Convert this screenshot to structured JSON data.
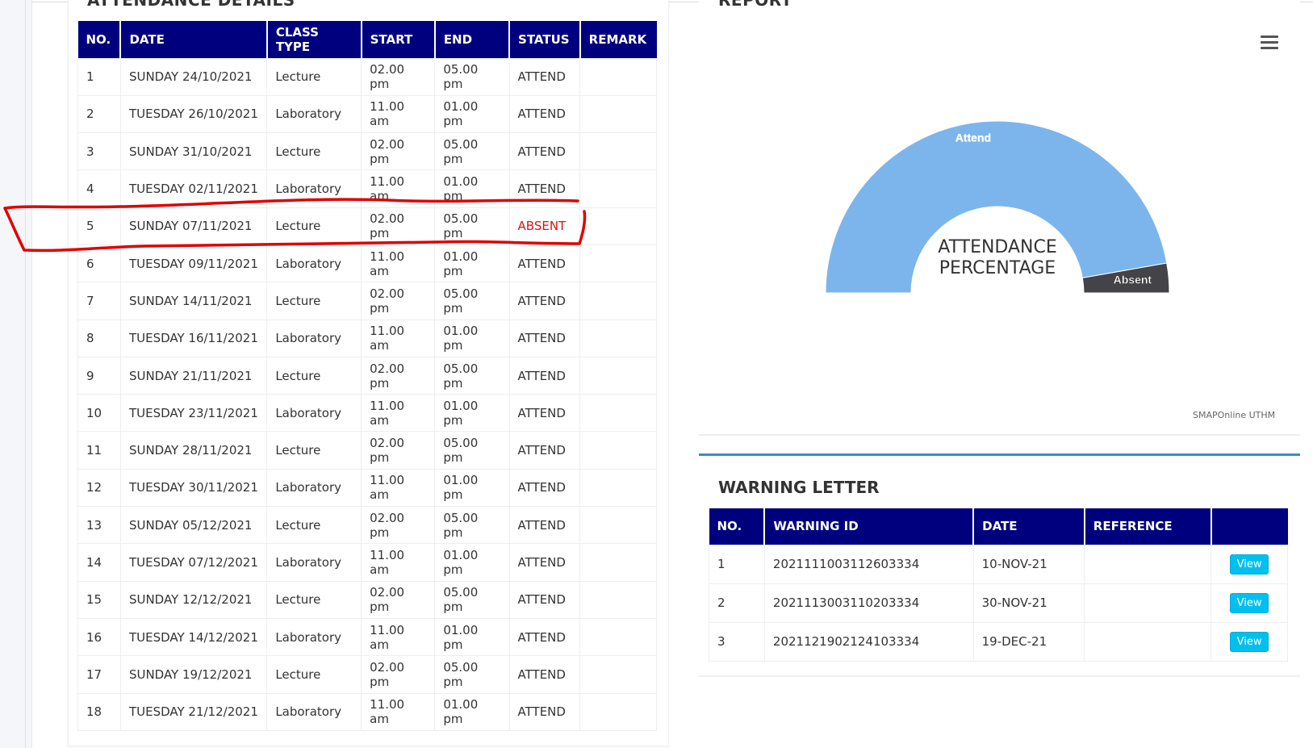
{
  "attendance": {
    "title": "ATTENDANCE DETAILS",
    "headers": [
      "NO.",
      "DATE",
      "CLASS TYPE",
      "START",
      "END",
      "STATUS",
      "REMARK"
    ],
    "rows": [
      {
        "no": "1",
        "date": "SUNDAY 24/10/2021",
        "type": "Lecture",
        "start": "02.00 pm",
        "end": "05.00 pm",
        "status": "ATTEND",
        "remark": ""
      },
      {
        "no": "2",
        "date": "TUESDAY 26/10/2021",
        "type": "Laboratory",
        "start": "11.00 am",
        "end": "01.00 pm",
        "status": "ATTEND",
        "remark": ""
      },
      {
        "no": "3",
        "date": "SUNDAY 31/10/2021",
        "type": "Lecture",
        "start": "02.00 pm",
        "end": "05.00 pm",
        "status": "ATTEND",
        "remark": ""
      },
      {
        "no": "4",
        "date": "TUESDAY 02/11/2021",
        "type": "Laboratory",
        "start": "11.00 am",
        "end": "01.00 pm",
        "status": "ATTEND",
        "remark": ""
      },
      {
        "no": "5",
        "date": "SUNDAY 07/11/2021",
        "type": "Lecture",
        "start": "02.00 pm",
        "end": "05.00 pm",
        "status": "ABSENT",
        "remark": ""
      },
      {
        "no": "6",
        "date": "TUESDAY 09/11/2021",
        "type": "Laboratory",
        "start": "11.00 am",
        "end": "01.00 pm",
        "status": "ATTEND",
        "remark": ""
      },
      {
        "no": "7",
        "date": "SUNDAY 14/11/2021",
        "type": "Lecture",
        "start": "02.00 pm",
        "end": "05.00 pm",
        "status": "ATTEND",
        "remark": ""
      },
      {
        "no": "8",
        "date": "TUESDAY 16/11/2021",
        "type": "Laboratory",
        "start": "11.00 am",
        "end": "01.00 pm",
        "status": "ATTEND",
        "remark": ""
      },
      {
        "no": "9",
        "date": "SUNDAY 21/11/2021",
        "type": "Lecture",
        "start": "02.00 pm",
        "end": "05.00 pm",
        "status": "ATTEND",
        "remark": ""
      },
      {
        "no": "10",
        "date": "TUESDAY 23/11/2021",
        "type": "Laboratory",
        "start": "11.00 am",
        "end": "01.00 pm",
        "status": "ATTEND",
        "remark": ""
      },
      {
        "no": "11",
        "date": "SUNDAY 28/11/2021",
        "type": "Lecture",
        "start": "02.00 pm",
        "end": "05.00 pm",
        "status": "ATTEND",
        "remark": ""
      },
      {
        "no": "12",
        "date": "TUESDAY 30/11/2021",
        "type": "Laboratory",
        "start": "11.00 am",
        "end": "01.00 pm",
        "status": "ATTEND",
        "remark": ""
      },
      {
        "no": "13",
        "date": "SUNDAY 05/12/2021",
        "type": "Lecture",
        "start": "02.00 pm",
        "end": "05.00 pm",
        "status": "ATTEND",
        "remark": ""
      },
      {
        "no": "14",
        "date": "TUESDAY 07/12/2021",
        "type": "Laboratory",
        "start": "11.00 am",
        "end": "01.00 pm",
        "status": "ATTEND",
        "remark": ""
      },
      {
        "no": "15",
        "date": "SUNDAY 12/12/2021",
        "type": "Lecture",
        "start": "02.00 pm",
        "end": "05.00 pm",
        "status": "ATTEND",
        "remark": ""
      },
      {
        "no": "16",
        "date": "TUESDAY 14/12/2021",
        "type": "Laboratory",
        "start": "11.00 am",
        "end": "01.00 pm",
        "status": "ATTEND",
        "remark": ""
      },
      {
        "no": "17",
        "date": "SUNDAY 19/12/2021",
        "type": "Lecture",
        "start": "02.00 pm",
        "end": "05.00 pm",
        "status": "ATTEND",
        "remark": ""
      },
      {
        "no": "18",
        "date": "TUESDAY 21/12/2021",
        "type": "Laboratory",
        "start": "11.00 am",
        "end": "01.00 pm",
        "status": "ATTEND",
        "remark": ""
      }
    ]
  },
  "report": {
    "title": "REPORT",
    "menu_icon": "hamburger-menu-icon",
    "credits": "SMAPOnline UTHM"
  },
  "chart_data": {
    "type": "pie",
    "title": "ATTENDANCE PERCENTAGE",
    "title_lines": [
      "ATTENDANCE",
      "PERCENTAGE"
    ],
    "variant": "semi-circle donut",
    "categories": [
      "Attend",
      "Absent"
    ],
    "values": [
      17,
      1
    ],
    "colors": [
      "#7cb5ec",
      "#434348"
    ]
  },
  "warning": {
    "title": "WARNING LETTER",
    "headers": [
      "NO.",
      "WARNING ID",
      "DATE",
      "REFERENCE",
      ""
    ],
    "view_label": "View",
    "rows": [
      {
        "no": "1",
        "id": "2021111003112603334",
        "date": "10-NOV-21",
        "reference": ""
      },
      {
        "no": "2",
        "id": "2021113003110203334",
        "date": "30-NOV-21",
        "reference": ""
      },
      {
        "no": "3",
        "id": "2021121902124103334",
        "date": "19-DEC-21",
        "reference": ""
      }
    ]
  },
  "colors": {
    "header_bg": "#00007f",
    "absent_text": "#e01010",
    "annotation_stroke": "#e00000",
    "view_button": "#00c0ef",
    "warning_border": "#3c8dbc"
  }
}
